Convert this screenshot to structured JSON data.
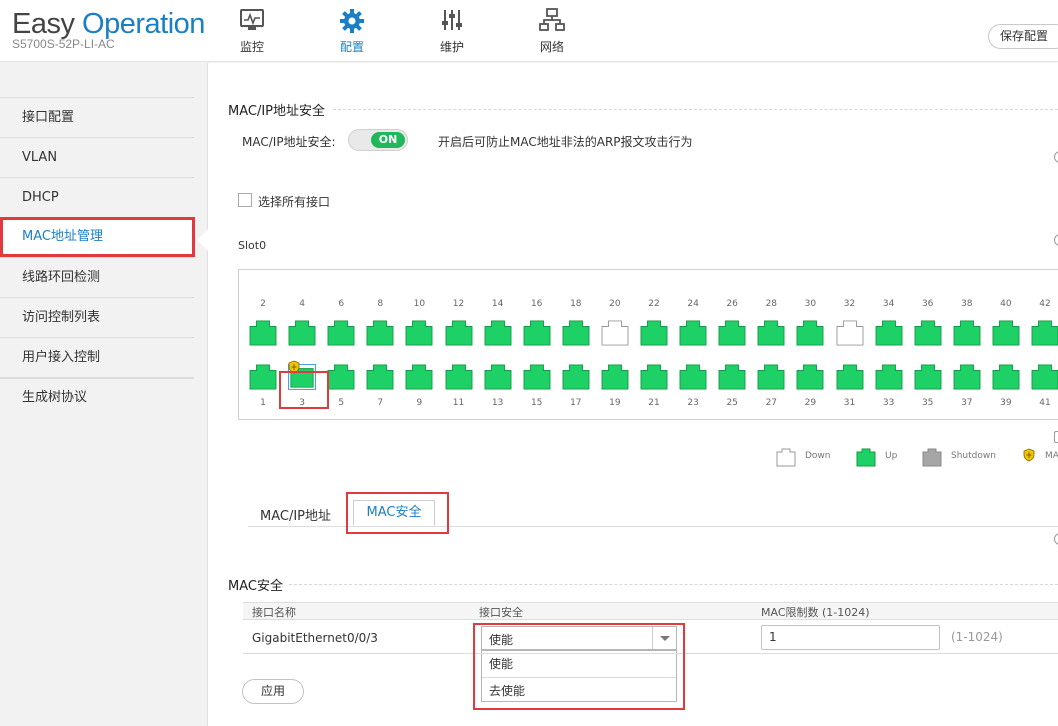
{
  "brand": {
    "name_part1": "Easy ",
    "name_part2": "Operation",
    "model": "S5700S-52P-LI-AC"
  },
  "nav": [
    {
      "label": "监控",
      "icon": "monitor-icon",
      "active": false
    },
    {
      "label": "配置",
      "icon": "gear-icon",
      "active": true
    },
    {
      "label": "维护",
      "icon": "sliders-icon",
      "active": false
    },
    {
      "label": "网络",
      "icon": "network-icon",
      "active": false
    }
  ],
  "header": {
    "save_label": "保存配置"
  },
  "sidebar": {
    "items": [
      {
        "label": "接口配置"
      },
      {
        "label": "VLAN"
      },
      {
        "label": "DHCP"
      },
      {
        "label": "MAC地址管理",
        "active": true
      },
      {
        "label": "线路环回检测"
      },
      {
        "label": "访问控制列表"
      },
      {
        "label": "用户接入控制"
      },
      {
        "label": "生成树协议"
      }
    ]
  },
  "main": {
    "section_title": "MAC/IP地址安全",
    "toggle_label": "MAC/IP地址安全:",
    "toggle_state": "ON",
    "toggle_hint": "开启后可防止MAC地址非法的ARP报文攻击行为",
    "select_all_label": "选择所有接口",
    "slot_label": "Slot0",
    "ports": {
      "top_numbers": [
        "2",
        "4",
        "6",
        "8",
        "10",
        "12",
        "14",
        "16",
        "18",
        "20",
        "22",
        "24",
        "26",
        "28",
        "30",
        "32",
        "34",
        "36",
        "38",
        "40",
        "42"
      ],
      "bottom_numbers": [
        "1",
        "3",
        "5",
        "7",
        "9",
        "11",
        "13",
        "15",
        "17",
        "19",
        "21",
        "23",
        "25",
        "27",
        "29",
        "31",
        "33",
        "35",
        "37",
        "39",
        "41"
      ],
      "top_status": [
        "up",
        "up",
        "up",
        "up",
        "up",
        "up",
        "up",
        "up",
        "up",
        "down",
        "up",
        "up",
        "up",
        "up",
        "up",
        "down",
        "up",
        "up",
        "up",
        "up",
        "up"
      ],
      "bottom_status": [
        "up",
        "selected",
        "up",
        "up",
        "up",
        "up",
        "up",
        "up",
        "up",
        "up",
        "up",
        "up",
        "up",
        "up",
        "up",
        "up",
        "up",
        "up",
        "up",
        "up",
        "up"
      ],
      "secured_port": "3"
    },
    "legend": {
      "down": "Down",
      "up": "Up",
      "shutdown": "Shutdown",
      "mac_prefix": "MA"
    },
    "tabs": {
      "mac_ip": "MAC/IP地址",
      "mac_security": "MAC安全"
    },
    "mac_section_title": "MAC安全",
    "table": {
      "columns": [
        "接口名称",
        "接口安全",
        "MAC限制数 (1-1024)"
      ],
      "row": {
        "interface": "GigabitEthernet0/0/3",
        "security_value": "使能",
        "mac_limit": "1",
        "range_hint": "(1-1024)"
      },
      "dropdown_options": [
        "使能",
        "去使能"
      ]
    },
    "apply_label": "应用"
  },
  "colors": {
    "accent": "#1a7fc4",
    "port_up": "#1ed167",
    "port_down": "#ffffff",
    "port_shutdown": "#a6a6a6",
    "toggle_on": "#1fb85a",
    "highlight": "#e0393e"
  }
}
